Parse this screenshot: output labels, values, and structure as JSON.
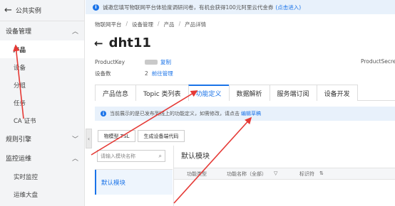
{
  "sidebar": {
    "back_label": "公共实例",
    "groups": [
      {
        "label": "设备管理",
        "items": [
          "产品",
          "设备",
          "分组",
          "任务",
          "CA 证书"
        ]
      },
      {
        "label": "规则引擎"
      },
      {
        "label": "监控运维",
        "items": [
          "实时监控",
          "运维大盘"
        ]
      }
    ]
  },
  "notice": {
    "text": "诚邀您填写物联网平台体验度调研问卷，有机会获得100元阿里云代金券",
    "link": "(点击进入)"
  },
  "breadcrumb": [
    "物联网平台",
    "设备管理",
    "产品",
    "产品详情"
  ],
  "product": {
    "name": "dht11",
    "productkey_label": "ProductKey",
    "copy_label": "复制",
    "device_count_label": "设备数",
    "device_count": "2",
    "manage_link": "前往管理",
    "secret_label": "ProductSecret"
  },
  "tabs": [
    "产品信息",
    "Topic 类列表",
    "功能定义",
    "数据解析",
    "服务端订阅",
    "设备开发"
  ],
  "active_tab": "功能定义",
  "info_strip": {
    "text": "当前展示的是已发布到线上的功能定义，如需修改，请点击",
    "link": "编辑草稿"
  },
  "buttons": {
    "tsl": "物模型 TSL",
    "gen_code": "生成设备端代码"
  },
  "module_search": {
    "placeholder": "请输入模块名称"
  },
  "modules": [
    "默认模块"
  ],
  "module_title": "默认模块",
  "table_headers": [
    "功能类型",
    "功能名称（全部）",
    "标识符"
  ],
  "colors": {
    "accent": "#1a73e8",
    "annotation": "#e53935"
  }
}
